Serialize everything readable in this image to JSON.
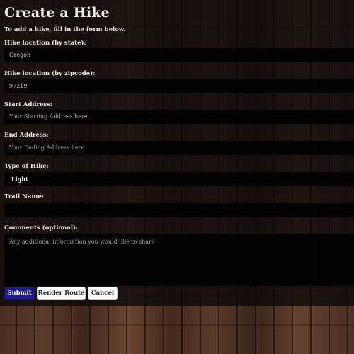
{
  "page": {
    "title": "Create a Hike",
    "intro": "To add a hike, fill in the form below."
  },
  "form": {
    "state_label": "Hike location (by state):",
    "state_value": "Oregon",
    "zip_label": "Hike location (by zipcode):",
    "zip_value": "97219",
    "start_label": "Start Address:",
    "start_placeholder": "Your Starting Address here",
    "end_label": "End Address:",
    "end_placeholder": "Your Ending Address here",
    "type_label": "Type of Hike:",
    "type_value": "Light",
    "trail_label": "Trail Name:",
    "trail_value": "",
    "comments_label": "Comments (optional):",
    "comments_placeholder": "Any additional information you would like to share"
  },
  "buttons": {
    "submit": "Submit",
    "render_route": "Render Route",
    "cancel": "Cancel"
  },
  "colors": {
    "submit_bg": "#1e1e8a",
    "secondary_bg": "#ffffff"
  }
}
